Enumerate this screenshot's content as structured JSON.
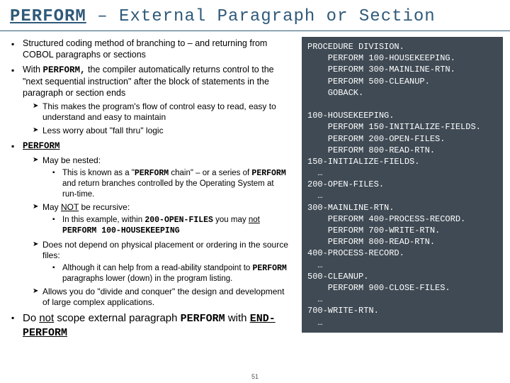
{
  "title": {
    "keyword": "PERFORM",
    "rest": " – External Paragraph or Section"
  },
  "bullets": {
    "b1": "Structured coding method of branching to – and returning from COBOL paragraphs or sections",
    "b2_pre": "With ",
    "b2_kw": "PERFORM,",
    "b2_post": " the compiler automatically returns control to the \"next sequential instruction\" after the block of statements in the paragraph or section ends",
    "b2_sub1": "This makes the program's flow of control easy to read, easy to understand and easy to maintain",
    "b2_sub2": "Less worry about \"fall thru\" logic",
    "b3": "PERFORM",
    "b3_sub1": "May be nested:",
    "b3_sub1_a_pre": "This is known as a \"",
    "b3_sub1_a_kw1": "PERFORM",
    "b3_sub1_a_mid": " chain\" – or a series of ",
    "b3_sub1_a_kw2": "PERFORM",
    "b3_sub1_a_post": " and return branches controlled by the Operating System at run-time.",
    "b3_sub2_pre": "May ",
    "b3_sub2_not": "NOT",
    "b3_sub2_post": " be recursive:",
    "b3_sub2_a_pre": "In this example, within ",
    "b3_sub2_a_code": "200-OPEN-FILES",
    "b3_sub2_a_mid": " you may ",
    "b3_sub2_a_not": "not",
    "b3_sub2_a_code2": " PERFORM 100-HOUSEKEEPING",
    "b3_sub3": "Does not depend on physical placement or ordering in the source files:",
    "b3_sub3_a_pre": "Although it can help from a read-ability standpoint to ",
    "b3_sub3_a_kw": "PERFORM",
    "b3_sub3_a_post": " paragraphs lower (down) in the program listing.",
    "b3_sub4": "Allows you do \"divide and conquer\" the design and development of large complex applications.",
    "b4_pre": "Do ",
    "b4_not": "not",
    "b4_mid": " scope external paragraph ",
    "b4_kw1": "PERFORM",
    "b4_mid2": " with ",
    "b4_kw2": "END-PERFORM"
  },
  "code": "PROCEDURE DIVISION.\n    PERFORM 100-HOUSEKEEPING.\n    PERFORM 300-MAINLINE-RTN.\n    PERFORM 500-CLEANUP.\n    GOBACK.\n\n100-HOUSEKEEPING.\n    PERFORM 150-INITIALIZE-FIELDS.\n    PERFORM 200-OPEN-FILES.\n    PERFORM 800-READ-RTN.\n150-INITIALIZE-FIELDS.\n  …\n200-OPEN-FILES.\n  …\n300-MAINLINE-RTN.\n    PERFORM 400-PROCESS-RECORD.\n    PERFORM 700-WRITE-RTN.\n    PERFORM 800-READ-RTN.\n400-PROCESS-RECORD.\n  …\n500-CLEANUP.\n    PERFORM 900-CLOSE-FILES.\n  …\n700-WRITE-RTN.\n  …",
  "page_number": "51"
}
